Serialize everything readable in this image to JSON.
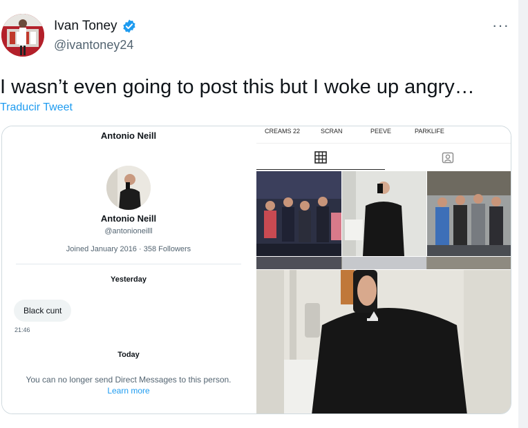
{
  "tweet": {
    "author_name": "Ivan Toney",
    "author_handle": "@ivantoney24",
    "more_label": "···",
    "text": "I wasn’t even going to post this but I woke up angry…",
    "translate_label": "Traducir Tweet"
  },
  "dm": {
    "header_name": "Antonio Neill",
    "profile_name": "Antonio Neill",
    "profile_handle": "@antonioneilll",
    "profile_meta": "Joined January 2016 · 358 Followers",
    "day_yesterday": "Yesterday",
    "message": "Black cunt",
    "message_time": "21:46",
    "day_today": "Today",
    "notice": "You can no longer send Direct Messages to this person.",
    "learn_more": "Learn more"
  },
  "instagram": {
    "highlights": [
      "CREAMS 22",
      "SCRAN",
      "PEEVE",
      "PARKLIFE"
    ],
    "active_tab": "grid"
  },
  "colors": {
    "link": "#1d9bf0",
    "verified": "#1d9bf0",
    "text_primary": "#0f1419",
    "text_secondary": "#536471"
  }
}
